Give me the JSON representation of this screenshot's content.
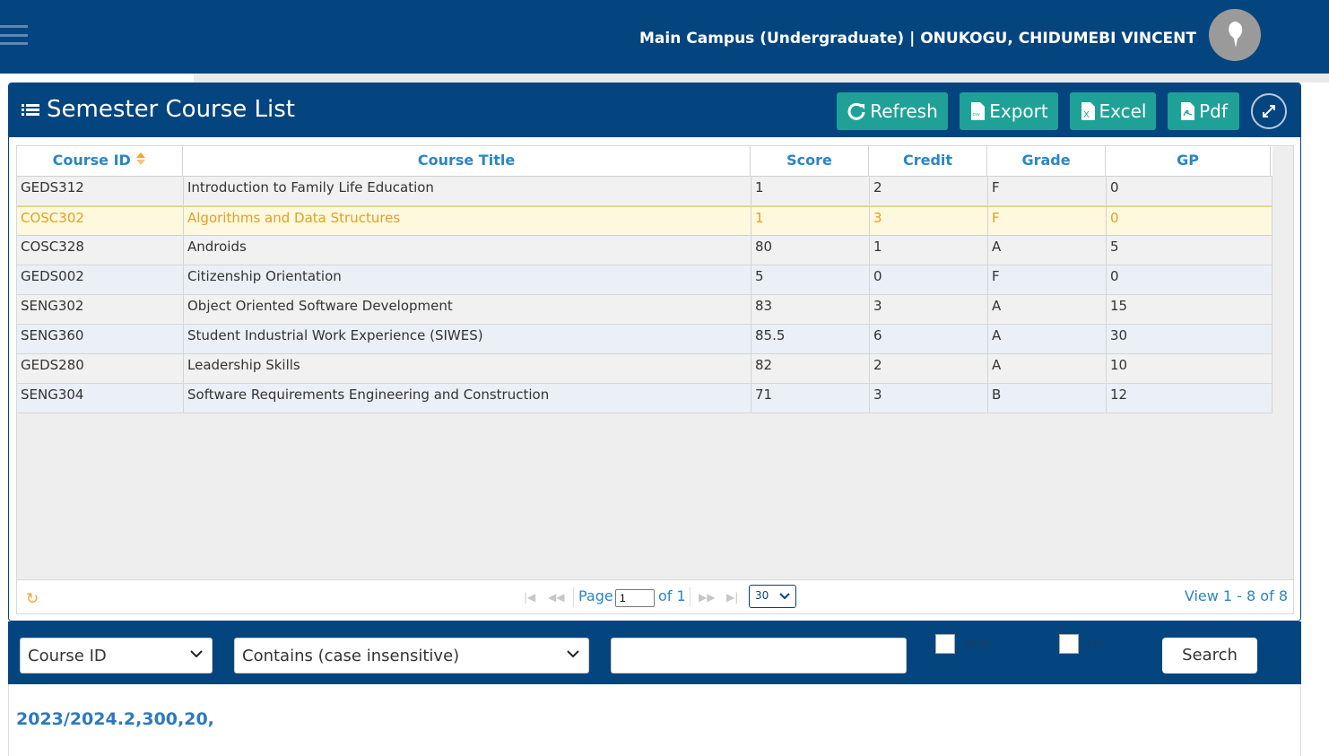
{
  "header": {
    "user_text": "Main Campus (Undergraduate) | ONUKOGU, CHIDUMEBI VINCENT",
    "menu_icon": "hamburger-menu-icon",
    "avatar_icon": "user-avatar-icon"
  },
  "panel": {
    "title": "Semester Course List",
    "buttons": {
      "refresh": "Refresh",
      "export": "Export",
      "excel": "Excel",
      "pdf": "Pdf"
    }
  },
  "table": {
    "columns": [
      "Course ID",
      "Course Title",
      "Score",
      "Credit",
      "Grade",
      "GP"
    ],
    "sort_column": "Course ID",
    "rows": [
      [
        "GEDS312",
        "Introduction to Family Life Education",
        "1",
        "2",
        "F",
        "0"
      ],
      [
        "COSC302",
        "Algorithms and Data Structures",
        "1",
        "3",
        "F",
        "0"
      ],
      [
        "COSC328",
        "Androids",
        "80",
        "1",
        "A",
        "5"
      ],
      [
        "GEDS002",
        "Citizenship Orientation",
        "5",
        "0",
        "F",
        "0"
      ],
      [
        "SENG302",
        "Object Oriented Software Development",
        "83",
        "3",
        "A",
        "15"
      ],
      [
        "SENG360",
        "Student Industrial Work Experience (SIWES)",
        "85.5",
        "6",
        "A",
        "30"
      ],
      [
        "GEDS280",
        "Leadership Skills",
        "82",
        "2",
        "A",
        "10"
      ],
      [
        "SENG304",
        "Software Requirements Engineering and Construction",
        "71",
        "3",
        "B",
        "12"
      ]
    ],
    "selected_row": 1
  },
  "pager": {
    "page_label": "Page",
    "page_value": "1",
    "of_label": "of 1",
    "page_size": "30",
    "view_text": "View 1 - 8 of 8"
  },
  "search": {
    "field": "Course ID",
    "operator": "Contains (case insensitive)",
    "value": "",
    "and_label": "And",
    "or_label": "Or",
    "button": "Search"
  },
  "footer": {
    "text": "2023/2024.2,300,20,"
  },
  "colors": {
    "primary": "#04457f",
    "accent_button": "#20a198",
    "link": "#2a86c6",
    "highlight": "#e0a123"
  }
}
